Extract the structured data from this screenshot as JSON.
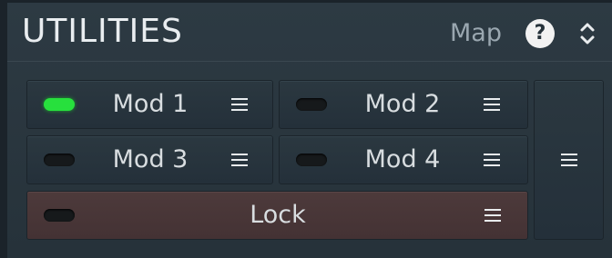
{
  "header": {
    "title": "UTILITIES",
    "map_label": "Map",
    "help_glyph": "?",
    "help_icon": "help-icon",
    "expand_icon": "expand-collapse-icon"
  },
  "buttons": [
    {
      "label": "Mod 1",
      "led_on": true
    },
    {
      "label": "Mod 2",
      "led_on": false
    },
    {
      "label": "Mod 3",
      "led_on": false
    },
    {
      "label": "Mod 4",
      "led_on": false
    },
    {
      "label": "Lock",
      "led_on": false
    }
  ],
  "menu_icon": "hamburger-menu-icon",
  "colors": {
    "panel": "#2d3a43",
    "led_on": "#27e03d",
    "led_off": "#16191b",
    "lock_bg": "#4d3a3b",
    "text": "#d8dde0"
  }
}
